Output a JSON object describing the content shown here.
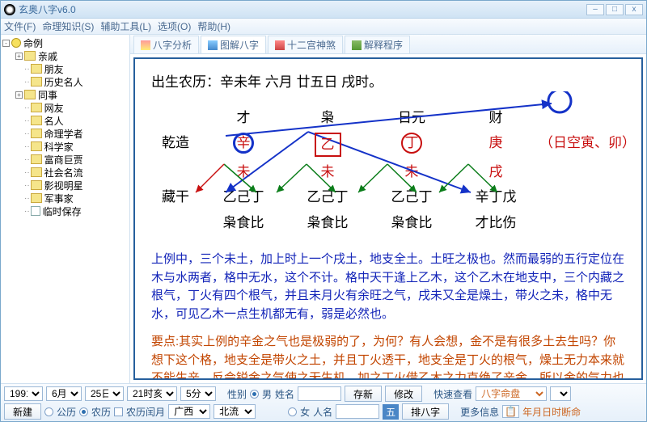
{
  "title": "玄奥八字v6.0",
  "menus": [
    "文件(F)",
    "命理知识(S)",
    "辅助工具(L)",
    "选项(O)",
    "帮助(H)"
  ],
  "tree": {
    "root": "命例",
    "items": [
      "亲戚",
      "朋友",
      "历史名人",
      "同事",
      "网友",
      "名人",
      "命理学者",
      "科学家",
      "富商巨贾",
      "社会名流",
      "影视明星",
      "军事家",
      "临时保存"
    ]
  },
  "tabs": [
    "八字分析",
    "图解八字",
    "十二宫神煞",
    "解释程序"
  ],
  "birth": "出生农历：辛未年 六月 廿五日 戌时。",
  "grid": {
    "col_labels": [
      "才",
      "枭",
      "日元",
      "财"
    ],
    "qianzao": "乾造",
    "stems": [
      "辛",
      "乙",
      "丁",
      "庚"
    ],
    "kongwang": "（日空寅、卯）",
    "branches": [
      "未",
      "未",
      "未",
      "戌"
    ],
    "canggan_lbl": "藏干",
    "canggan": [
      "乙己丁",
      "乙己丁",
      "乙己丁",
      "辛丁戊"
    ],
    "shishen": [
      "枭食比",
      "枭食比",
      "枭食比",
      "才比伤"
    ]
  },
  "para1": "上例中，三个未土，加上时上一个戌土，地支全土。土旺之极也。然而最弱的五行定位在木与水两者，格中无水，这个不计。格中天干逢上乙木，这个乙木在地支中，三个内藏之根气，丁火有四个根气，并且未月火有余旺之气，戌未又全是燥土，带火之未，格中无水，可见乙木一点生机都无有，弱是必然也。",
  "para2": "要点:其实上例的辛金之气也是极弱的了，为何？有人会想，金不是有很多土去生吗？你想下这个格，地支全是带火之土，并且丁火透干，地支全是丁火的根气，燥土无力本来就不能生辛，反会锐金之气使之无生机，加之丁火借乙木之力克绝了辛金，所以金的气力也是十分之弱的了。",
  "bottom": {
    "year": "1991",
    "month": "6月",
    "day": "25日",
    "hour": "21时亥",
    "minute": "5分",
    "newbtn": "新建",
    "gongli": "公历",
    "nongli": "农历",
    "nonglirun": "农历闰月",
    "prov": "广西",
    "city": "北流",
    "sexlbl": "性别",
    "male": "男",
    "female": "女",
    "namelbl": "姓名",
    "renlbl": "人名",
    "savebtn": "存新",
    "modbtn": "修改",
    "paibtn": "排八字",
    "quicklbl": "快速查看",
    "quickval": "八字命盘",
    "morelbl": "更多信息",
    "bico": "年月日时断命"
  }
}
